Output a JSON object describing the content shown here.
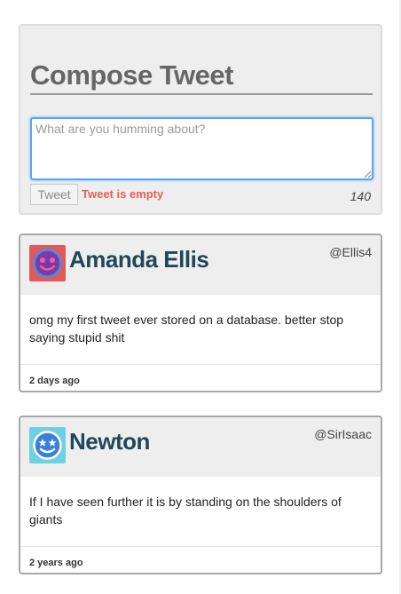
{
  "compose": {
    "title": "Compose Tweet",
    "placeholder": "What are you humming about?",
    "button_label": "Tweet",
    "error": "Tweet is empty",
    "char_count": "140"
  },
  "tweets": [
    {
      "name": "Amanda Ellis",
      "handle": "@Ellis4",
      "text": "omg my first tweet ever stored on a database. better stop saying stupid shit",
      "time": "2 days ago",
      "avatar_icon": "smiley-face-icon",
      "avatar_bg": "#e0595b"
    },
    {
      "name": "Newton",
      "handle": "@SirIsaac",
      "text": "If I have seen further it is by standing on the shoulders of giants",
      "time": "2 years ago",
      "avatar_icon": "star-eyes-face-icon",
      "avatar_bg": "#6fd0e4"
    }
  ],
  "colors": {
    "accent_focus": "#5aa5f0",
    "error": "#e8605a",
    "name_text": "#1f4858"
  }
}
